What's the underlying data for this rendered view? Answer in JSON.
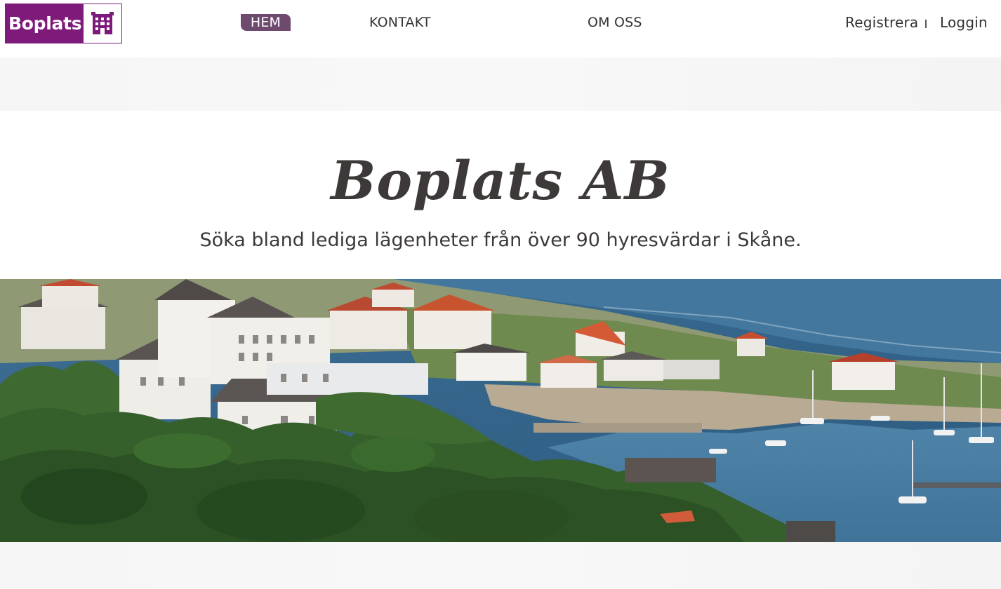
{
  "brand": {
    "name": "Boplats",
    "icon": "building-icon",
    "colors": {
      "primary": "#7d1a7a",
      "nav_active": "#6f4a6f"
    }
  },
  "nav": {
    "home": "HEM",
    "contact": "KONTAKT",
    "about": "OM OSS",
    "register": "Registrera",
    "login": "Loggin"
  },
  "hero": {
    "title": "Boplats AB",
    "subtitle": "Söka bland lediga lägenheter från över 90 hyresvärdar i Skåne.",
    "image": "harbour-town-photo"
  }
}
